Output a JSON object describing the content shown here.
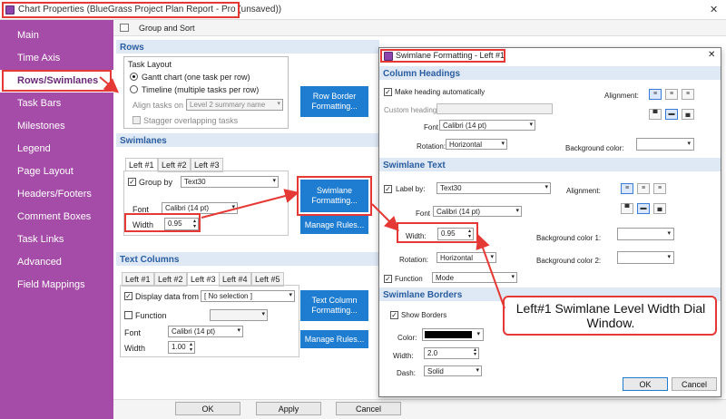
{
  "main_window": {
    "title": "Chart Properties (BlueGrass Project Plan Report - Pro (unsaved))",
    "toolbar_label": "Group and Sort",
    "close_glyph": "✕"
  },
  "sidebar": {
    "items": [
      {
        "label": "Main"
      },
      {
        "label": "Time Axis"
      },
      {
        "label": "Rows/Swimlanes"
      },
      {
        "label": "Task Bars"
      },
      {
        "label": "Milestones"
      },
      {
        "label": "Legend"
      },
      {
        "label": "Page Layout"
      },
      {
        "label": "Headers/Footers"
      },
      {
        "label": "Comment Boxes"
      },
      {
        "label": "Task Links"
      },
      {
        "label": "Advanced"
      },
      {
        "label": "Field Mappings"
      }
    ]
  },
  "rows": {
    "header": "Rows",
    "task_layout_label": "Task Layout",
    "gantt_option": "Gantt chart (one task per row)",
    "timeline_option": "Timeline (multiple tasks per row)",
    "align_tasks_label": "Align tasks on",
    "align_tasks_value": "Level 2 summary name",
    "stagger_label": "Stagger overlapping tasks",
    "row_border_button": "Row Border\nFormatting..."
  },
  "swimlanes": {
    "header": "Swimlanes",
    "tabs": [
      "Left #1",
      "Left #2",
      "Left #3"
    ],
    "group_by_label": "Group by",
    "group_by_value": "Text30",
    "font_label": "Font",
    "font_value": "Calibri (14 pt)",
    "width_label": "Width",
    "width_value": "0.95",
    "swimlane_button": "Swimlane\nFormatting...",
    "manage_rules_button": "Manage Rules..."
  },
  "text_columns": {
    "header": "Text Columns",
    "tabs": [
      "Left #1",
      "Left #2",
      "Left #3",
      "Left #4",
      "Left #5"
    ],
    "display_label": "Display data from",
    "display_value": "[ No selection ]",
    "function_label": "Function",
    "font_label": "Font",
    "font_value": "Calibri (14 pt)",
    "width_label": "Width",
    "width_value": "1.00",
    "text_col_button": "Text Column\nFormatting...",
    "manage_rules_button": "Manage Rules..."
  },
  "footer": {
    "ok": "OK",
    "apply": "Apply",
    "cancel": "Cancel"
  },
  "dialog": {
    "title": "Swimlane Formatting - Left #1",
    "close_glyph": "✕",
    "col_headings": {
      "header": "Column Headings",
      "make_heading_label": "Make heading automatically",
      "custom_heading_label": "Custom heading:",
      "font_label": "Font",
      "font_value": "Calibri (14 pt)",
      "rotation_label": "Rotation:",
      "rotation_value": "Horizontal",
      "alignment_label": "Alignment:",
      "bg_color_label": "Background color:"
    },
    "swimlane_text": {
      "header": "Swimlane Text",
      "label_by_label": "Label by:",
      "label_by_value": "Text30",
      "font_label": "Font",
      "font_value": "Calibri (14 pt)",
      "width_label": "Width:",
      "width_value": "0.95",
      "rotation_label": "Rotation:",
      "rotation_value": "Horizontal",
      "function_label": "Function",
      "function_value": "Mode",
      "alignment_label": "Alignment:",
      "bg1_label": "Background color 1:",
      "bg2_label": "Background color 2:"
    },
    "borders": {
      "header": "Swimlane Borders",
      "show_borders_label": "Show Borders",
      "color_label": "Color:",
      "color_value": "#000000",
      "width_label": "Width:",
      "width_value": "2.0",
      "dash_label": "Dash:",
      "dash_value": "Solid"
    },
    "ok": "OK",
    "cancel": "Cancel"
  },
  "callout": {
    "text": "Left#1 Swimlane Level Width Dial Window."
  },
  "colors": {
    "sidebar": "#a54ca8",
    "accent_blue": "#1e7dd0",
    "highlight_red": "#e53935",
    "section_header_bg": "#dfe9f6"
  }
}
